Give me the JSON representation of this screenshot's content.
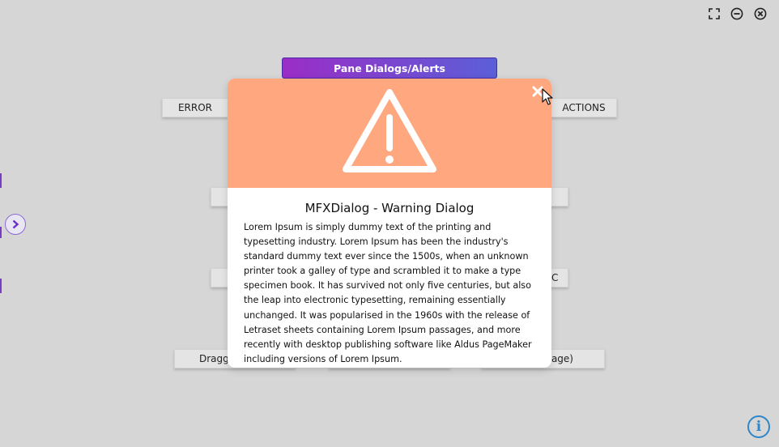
{
  "window_controls": [
    {
      "icon": "fullscreen-icon"
    },
    {
      "icon": "minimize-icon"
    },
    {
      "icon": "close-icon"
    }
  ],
  "background": {
    "pane_button_label": "Pane Dialogs/Alerts",
    "error_label": "ERROR",
    "actions_label": "ACTIONS",
    "partial_left_label": "Dragga",
    "partial_right_label": "tage)",
    "partial_c_label": "C"
  },
  "dialog": {
    "title": "MFXDialog - Warning Dialog",
    "body": "Lorem Ipsum is simply dummy text of the printing and typesetting industry. Lorem Ipsum has been the industry's standard dummy text ever since the 1500s, when an unknown printer took a galley of type and scrambled it to make a type specimen book. It has survived not only five centuries, but also the leap into electronic typesetting, remaining essentially unchanged. It was popularised in the 1960s with the release of Letraset sheets containing Lorem Ipsum passages, and more recently with desktop publishing software like Aldus PageMaker including versions of Lorem Ipsum.",
    "header_color": "#ffa77f",
    "icon": "warning-icon"
  },
  "info_button_label": "i",
  "colors": {
    "accent_start": "#9b2dc6",
    "accent_end": "#5b5fd8",
    "info": "#2f86c8"
  }
}
